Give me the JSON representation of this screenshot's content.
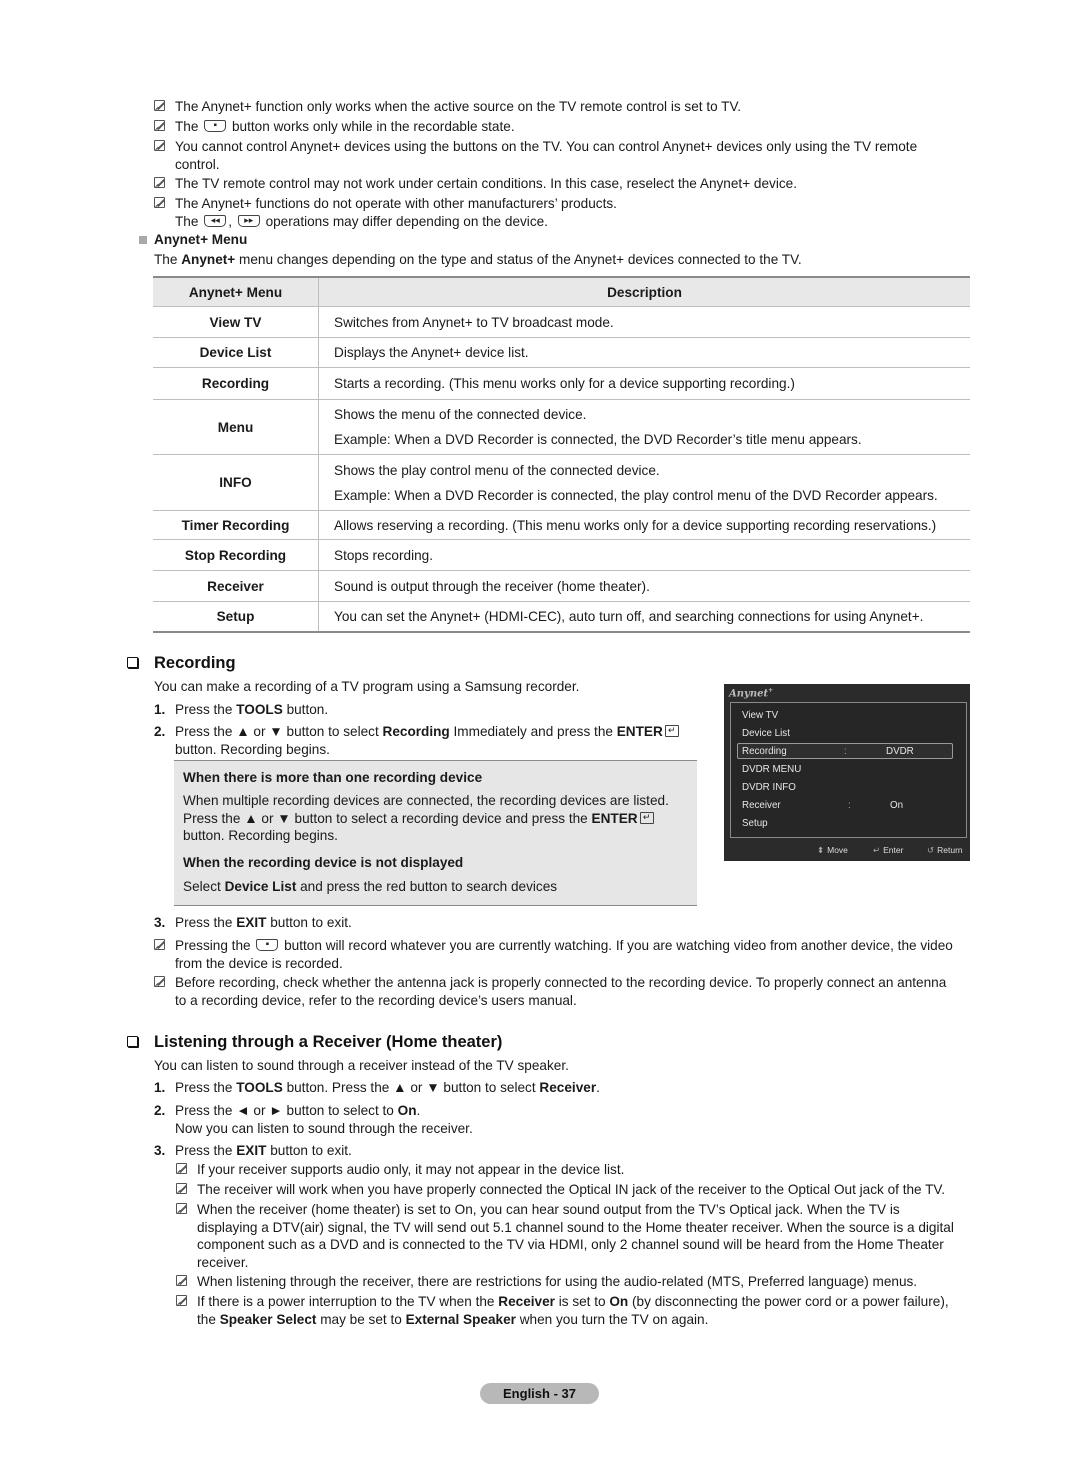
{
  "top_notes": [
    {
      "text": "The Anynet+ function only works when the active source on the TV remote control is set to TV."
    },
    {
      "pre": "The",
      "post": "button works only while in the recordable state.",
      "glyph": "record-button"
    },
    {
      "line1": "You cannot control Anynet+ devices using the buttons on the TV. You can control Anynet+ devices only using the TV remote",
      "line2": "control."
    },
    {
      "text": "The TV remote control may not work under certain conditions. In this case, reselect the Anynet+ device."
    },
    {
      "line1": "The Anynet+ functions do not operate with other manufacturers’ products.",
      "pre2": "The",
      "sep2": ",",
      "post2": "operations may differ depending on the device."
    }
  ],
  "anynet_menu_section": {
    "heading": "Anynet+ Menu",
    "intro_pre": "The",
    "intro_bold": "Anynet+",
    "intro_post": "menu changes depending on the type and status of the Anynet+ devices connected to the TV."
  },
  "table": {
    "headers": [
      "Anynet+ Menu",
      "Description"
    ],
    "rows": [
      {
        "menu": "View TV",
        "desc": [
          "Switches from Anynet+ to TV broadcast mode."
        ]
      },
      {
        "menu": "Device List",
        "desc": [
          "Displays the Anynet+ device list."
        ]
      },
      {
        "menu": "Recording",
        "desc": [
          "Starts a recording. (This menu works only for a device supporting recording.)"
        ]
      },
      {
        "menu": "Menu",
        "desc": [
          "Shows the menu of the connected device.",
          "Example: When a DVD Recorder is connected, the DVD Recorder’s title menu appears."
        ]
      },
      {
        "menu": "INFO",
        "desc": [
          "Shows the play control menu of the connected device.",
          "Example: When a DVD Recorder is connected, the play control menu of the DVD Recorder appears."
        ]
      },
      {
        "menu": "Timer Recording",
        "desc": [
          "Allows reserving a recording. (This menu works only for a device supporting recording reservations.)"
        ]
      },
      {
        "menu": "Stop Recording",
        "desc": [
          "Stops recording."
        ]
      },
      {
        "menu": "Receiver",
        "desc": [
          "Sound is output through the receiver (home theater)."
        ]
      },
      {
        "menu": "Setup",
        "desc": [
          "You can set the Anynet+ (HDMI-CEC), auto turn off, and searching connections for using Anynet+."
        ]
      }
    ]
  },
  "recording": {
    "title": "Recording",
    "intro": "You can make a recording of a TV program using a Samsung recorder.",
    "step1": {
      "num": "1.",
      "pre": "Press the",
      "bold": "TOOLS",
      "post": "button."
    },
    "step2": {
      "num": "2.",
      "pre": "Press the ▲ or ▼ button to select",
      "bold1": "Recording",
      "mid": "Immediately and press the",
      "bold2": "ENTER",
      "line2": "button. Recording begins."
    },
    "panel": {
      "h1": "When there is more than one recording device",
      "t1_line1": "When multiple recording devices are connected, the recording devices are listed.",
      "t1_line2_pre": "Press the ▲ or ▼ button to select a recording device and press the",
      "t1_line2_bold": "ENTER",
      "t1_line3": "button. Recording begins.",
      "h2": "When the recording device is not displayed",
      "t2_pre": "Select",
      "t2_bold": "Device List",
      "t2_post": "and press the red button to search devices"
    },
    "step3": {
      "num": "3.",
      "pre": "Press the",
      "bold": "EXIT",
      "post": "button to exit."
    },
    "notes": [
      {
        "pre": "Pressing the",
        "post": "button will record whatever you are currently watching. If you are watching video from another device, the video",
        "line2": "from the device is recorded."
      },
      {
        "line1": "Before recording, check whether the antenna jack is properly connected to the recording device. To properly connect an antenna",
        "line2": "to a recording device, refer to the recording device’s users manual."
      }
    ]
  },
  "osd": {
    "logo": "Anynet",
    "logo_sup": "+",
    "items": [
      {
        "label": "View TV",
        "value": ""
      },
      {
        "label": "Device List",
        "value": ""
      },
      {
        "label": "Recording",
        "value": "DVDR",
        "selected": true
      },
      {
        "label": "DVDR MENU",
        "value": ""
      },
      {
        "label": "DVDR INFO",
        "value": ""
      },
      {
        "label": "Receiver",
        "value": "On"
      },
      {
        "label": "Setup",
        "value": ""
      }
    ],
    "colon": ":",
    "footer": {
      "move": "Move",
      "enter": "Enter",
      "return": "Return"
    }
  },
  "receiver": {
    "title": "Listening through a Receiver (Home theater)",
    "intro": "You can listen to sound through a receiver instead of the TV speaker.",
    "step1": {
      "num": "1.",
      "pre": "Press the",
      "bold1": "TOOLS",
      "mid": "button. Press the ▲ or ▼ button to select",
      "bold2": "Receiver",
      "post": "."
    },
    "step2": {
      "num": "2.",
      "pre": "Press the ◄ or ► button to select to",
      "bold": "On",
      "post": ".",
      "line2": "Now you can listen to sound through the receiver."
    },
    "step3": {
      "num": "3.",
      "pre": "Press the",
      "bold": "EXIT",
      "post": "button to exit."
    },
    "notes": [
      {
        "text": "If your receiver supports audio only, it may not appear in the device list."
      },
      {
        "text": "The receiver will work when you have properly connected the Optical IN jack of the receiver to the Optical Out jack of the TV."
      },
      {
        "line1": "When the receiver (home theater) is set to On, you can hear sound output from the TV’s Optical jack. When the TV is",
        "line2": "displaying a DTV(air) signal, the TV will send out 5.1 channel sound to the Home theater receiver. When the source is a digital",
        "line3": "component such as a DVD and is connected to the TV via HDMI, only 2 channel sound will be heard from the Home Theater",
        "line4": "receiver."
      },
      {
        "text": "When listening through the receiver, there are restrictions for using the audio-related (MTS, Preferred language) menus."
      },
      {
        "pre": "If there is a power interruption to the TV when the",
        "bold1": "Receiver",
        "mid1": "is set to",
        "bold2": "On",
        "post1": "(by disconnecting the power cord or a power failure),",
        "l2_pre": "the",
        "l2_bold1": "Speaker Select",
        "l2_mid": "may be set to",
        "l2_bold2": "External Speaker",
        "l2_post": "when you turn the TV on again."
      }
    ]
  },
  "footer": {
    "page_label": "English - 37"
  }
}
